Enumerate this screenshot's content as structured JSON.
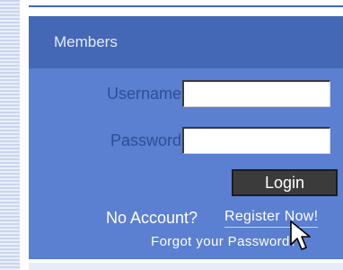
{
  "panel": {
    "title": "Members"
  },
  "form": {
    "username_label": "Username",
    "password_label": "Password",
    "username_value": "",
    "password_value": "",
    "login_label": "Login"
  },
  "links": {
    "no_account_text": "No Account?",
    "register_label": "Register Now!",
    "forgot_label": "Forgot your Password?"
  },
  "colors": {
    "panel_bg": "#5b7fd1",
    "header_bg": "#4468b6",
    "label_text": "#2f4e98",
    "button_bg": "#3b3b3b"
  },
  "icons": {
    "cursor": "mouse-pointer-icon"
  }
}
